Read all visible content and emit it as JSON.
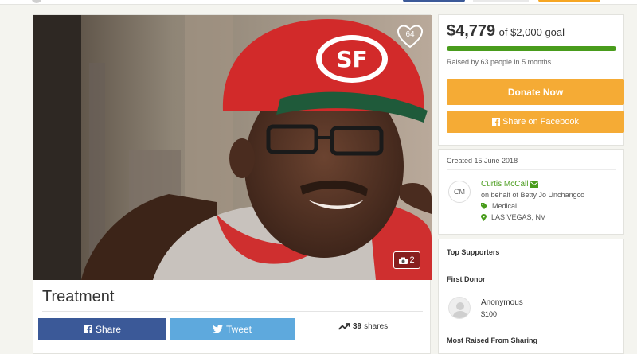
{
  "campaign": {
    "title": "Treatment",
    "photo_count": "64",
    "gallery_count": "2"
  },
  "share": {
    "facebook_label": "Share",
    "twitter_label": "Tweet",
    "shares_count": "39",
    "shares_label": "shares"
  },
  "funding": {
    "amount": "$4,779",
    "goal_text": "of $2,000 goal",
    "progress_fraction": 1.0,
    "raised_by": "Raised by 63 people in 5 months",
    "donate_label": "Donate Now",
    "fb_share_label": "Share on Facebook"
  },
  "details": {
    "created": "Created 15 June 2018",
    "organizer_initials": "CM",
    "organizer_name": "Curtis McCall",
    "on_behalf": "on behalf of Betty Jo Unchangco",
    "category": "Medical",
    "location": "LAS VEGAS, NV"
  },
  "supporters": {
    "heading": "Top Supporters",
    "first_donor_heading": "First Donor",
    "donor_name": "Anonymous",
    "donor_amount": "$100",
    "most_raised_heading": "Most Raised From Sharing"
  },
  "colors": {
    "facebook": "#3b5998",
    "twitter": "#5ea9dd",
    "donate": "#f5ab35",
    "progress": "#499c1c",
    "organizer_link": "#499c1c"
  },
  "icons": [
    "heart-icon",
    "camera-icon",
    "facebook-icon",
    "twitter-icon",
    "trending-icon",
    "envelope-icon",
    "tag-icon",
    "map-marker-icon",
    "user-silhouette-icon"
  ]
}
